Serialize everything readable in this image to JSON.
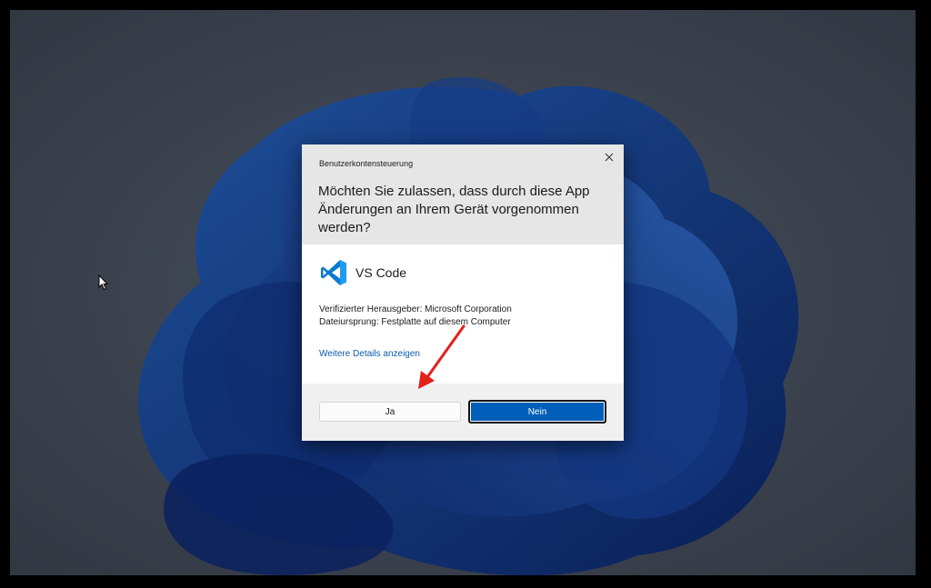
{
  "dialog": {
    "caption": "Benutzerkontensteuerung",
    "question": "Möchten Sie zulassen, dass durch diese App Änderungen an Ihrem Gerät vorgenommen werden?",
    "app_name": "VS Code",
    "publisher": "Verifizierter Herausgeber: Microsoft Corporation",
    "origin": "Dateiursprung: Festplatte auf diesem Computer",
    "details_link": "Weitere Details anzeigen",
    "yes_label": "Ja",
    "no_label": "Nein"
  },
  "icons": {
    "close": "close-icon",
    "app": "vscode-icon",
    "cursor": "mouse-cursor-icon",
    "annotation": "red-arrow-icon"
  },
  "colors": {
    "accent": "#005fb8",
    "link": "#0b5cad",
    "annotation": "#e3201b",
    "vscode_blue": "#0a7ad0"
  }
}
